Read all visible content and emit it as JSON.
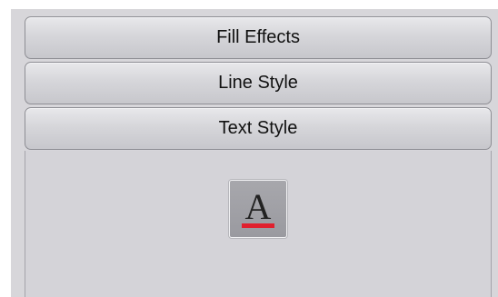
{
  "accordion": {
    "fill_effects_label": "Fill Effects",
    "line_style_label": "Line Style",
    "text_style_label": "Text Style"
  },
  "text_style_panel": {
    "swatch_icon": "font-color-icon",
    "swatch_glyph": "A",
    "colors": {
      "glyph": "#222222",
      "underline": "#e0202e",
      "swatch_bg": "#9f9fa5"
    }
  }
}
